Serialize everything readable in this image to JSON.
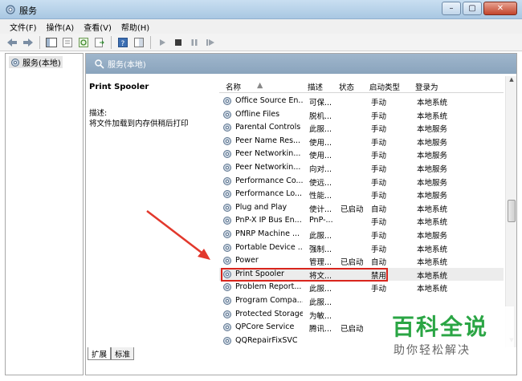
{
  "window": {
    "title": "服务"
  },
  "menu": [
    "文件(F)",
    "操作(A)",
    "查看(V)",
    "帮助(H)"
  ],
  "tree": {
    "root": "服务(本地)"
  },
  "pane": {
    "header": "服务(本地)",
    "selected_service": "Print Spooler",
    "desc_label": "描述:",
    "desc_text": "将文件加载到内存供稍后打印"
  },
  "columns": {
    "name": "名称",
    "desc": "描述",
    "status": "状态",
    "startup": "启动类型",
    "logon": "登录为"
  },
  "services": [
    {
      "name": "Office Source En...",
      "desc": "可保...",
      "status": "",
      "startup": "手动",
      "logon": "本地系统"
    },
    {
      "name": "Offline Files",
      "desc": "脱机...",
      "status": "",
      "startup": "手动",
      "logon": "本地系统"
    },
    {
      "name": "Parental Controls",
      "desc": "此服...",
      "status": "",
      "startup": "手动",
      "logon": "本地服务"
    },
    {
      "name": "Peer Name Res...",
      "desc": "使用...",
      "status": "",
      "startup": "手动",
      "logon": "本地服务"
    },
    {
      "name": "Peer Networkin...",
      "desc": "使用...",
      "status": "",
      "startup": "手动",
      "logon": "本地服务"
    },
    {
      "name": "Peer Networkin...",
      "desc": "向对...",
      "status": "",
      "startup": "手动",
      "logon": "本地服务"
    },
    {
      "name": "Performance Co...",
      "desc": "使远...",
      "status": "",
      "startup": "手动",
      "logon": "本地服务"
    },
    {
      "name": "Performance Lo...",
      "desc": "性能...",
      "status": "",
      "startup": "手动",
      "logon": "本地服务"
    },
    {
      "name": "Plug and Play",
      "desc": "使计...",
      "status": "已启动",
      "startup": "自动",
      "logon": "本地系统"
    },
    {
      "name": "PnP-X IP Bus En...",
      "desc": "PnP-...",
      "status": "",
      "startup": "手动",
      "logon": "本地系统"
    },
    {
      "name": "PNRP Machine ...",
      "desc": "此服...",
      "status": "",
      "startup": "手动",
      "logon": "本地服务"
    },
    {
      "name": "Portable Device ...",
      "desc": "强制...",
      "status": "",
      "startup": "手动",
      "logon": "本地系统"
    },
    {
      "name": "Power",
      "desc": "管理...",
      "status": "已启动",
      "startup": "自动",
      "logon": "本地系统"
    },
    {
      "name": "Print Spooler",
      "desc": "将文...",
      "status": "",
      "startup": "禁用",
      "logon": "本地系统"
    },
    {
      "name": "Problem Report...",
      "desc": "此服...",
      "status": "",
      "startup": "手动",
      "logon": "本地系统"
    },
    {
      "name": "Program Compa...",
      "desc": "此服...",
      "status": "",
      "startup": "",
      "logon": ""
    },
    {
      "name": "Protected Storage",
      "desc": "为敏...",
      "status": "",
      "startup": "",
      "logon": ""
    },
    {
      "name": "QPCore Service",
      "desc": "腾讯...",
      "status": "已启动",
      "startup": "",
      "logon": ""
    },
    {
      "name": "QQRepairFixSVC",
      "desc": "",
      "status": "",
      "startup": "",
      "logon": ""
    }
  ],
  "tabs": [
    "扩展",
    "标准"
  ],
  "watermark": {
    "title": "百科全说",
    "subtitle": "助你轻松解决"
  },
  "colors": {
    "highlight": "#d9251d",
    "arrow": "#e2382c",
    "watermark": "#2aa544"
  }
}
